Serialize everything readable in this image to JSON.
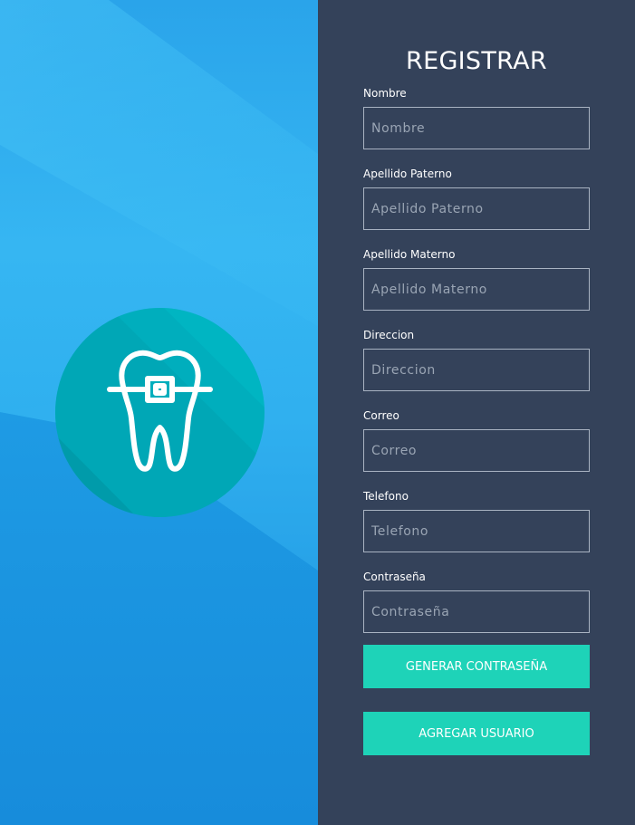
{
  "form": {
    "title": "REGISTRAR",
    "fields": [
      {
        "label": "Nombre",
        "placeholder": "Nombre",
        "value": ""
      },
      {
        "label": "Apellido Paterno",
        "placeholder": "Apellido Paterno",
        "value": ""
      },
      {
        "label": "Apellido Materno",
        "placeholder": "Apellido Materno",
        "value": ""
      },
      {
        "label": "Direccion",
        "placeholder": "Direccion",
        "value": ""
      },
      {
        "label": "Correo",
        "placeholder": "Correo",
        "value": ""
      },
      {
        "label": "Telefono",
        "placeholder": "Telefono",
        "value": ""
      },
      {
        "label": "Contraseña",
        "placeholder": "Contraseña",
        "value": ""
      }
    ],
    "buttons": {
      "generate_password": "GENERAR CONTRASEÑA",
      "add_user": "AGREGAR USUARIO"
    }
  },
  "logo": {
    "icon": "tooth-braces-icon",
    "circle_color": "#00aebd"
  },
  "colors": {
    "panel_background": "#34425a",
    "accent_button": "#1ed3b8",
    "left_background": "#2fb0ef"
  }
}
